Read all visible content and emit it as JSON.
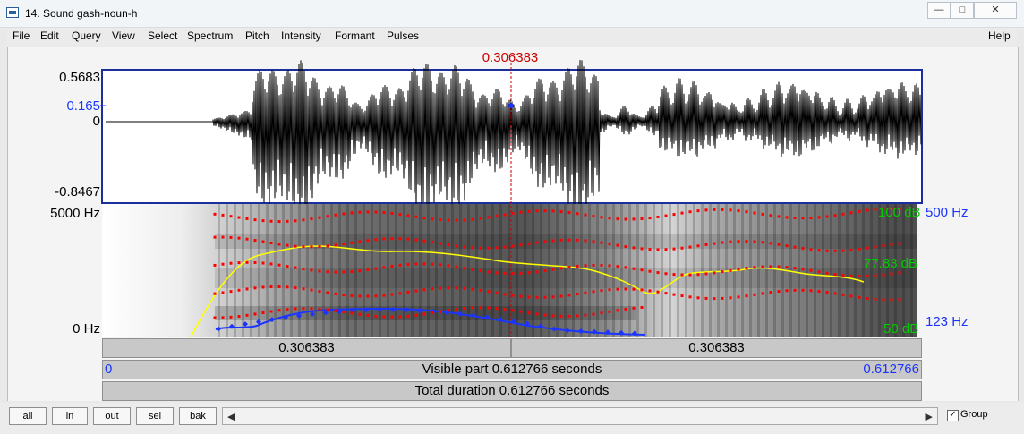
{
  "window": {
    "title": "14. Sound gash-noun-h"
  },
  "menu": [
    "File",
    "Edit",
    "Query",
    "View",
    "Select",
    "Spectrum",
    "Pitch",
    "Intensity",
    "Formant",
    "Pulses"
  ],
  "help": "Help",
  "cursor": {
    "time": "0.306383"
  },
  "waveform_axis": {
    "max": "0.5683",
    "cursor_value": "0.165",
    "zero": "0",
    "min": "-0.8467"
  },
  "spectrogram_axis": {
    "top": "5000 Hz",
    "bottom": "0 Hz"
  },
  "right_axis": {
    "intensity_top": "100 dB",
    "intensity_mid": "77.83 dB",
    "intensity_bottom": "50 dB",
    "pitch_top": "500 Hz",
    "pitch_bottom": "123 Hz"
  },
  "timebars": {
    "left_segment": "0.306383",
    "right_segment": "0.306383",
    "visible_left": "0",
    "visible_label": "Visible part 0.612766 seconds",
    "visible_right": "0.612766",
    "total": "Total duration 0.612766 seconds"
  },
  "buttons": {
    "all": "all",
    "in": "in",
    "out": "out",
    "sel": "sel",
    "bak": "bak"
  },
  "group": {
    "label": "Group",
    "checked": "✓"
  },
  "colors": {
    "cursor": "#cc0000",
    "pitch": "#1b35ff",
    "intensity": "#ffff00",
    "formant": "#ff0000",
    "db_labels": "#00cc00"
  }
}
